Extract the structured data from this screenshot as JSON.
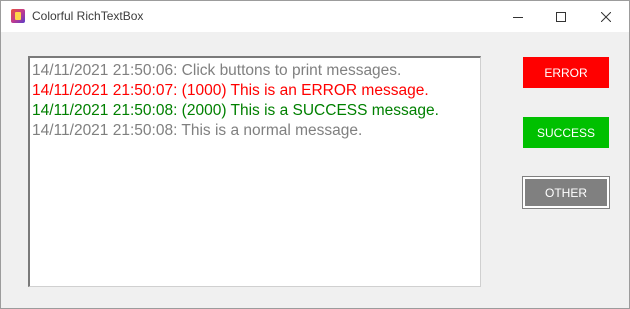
{
  "window": {
    "title": "Colorful RichTextBox"
  },
  "titlebar_controls": {
    "minimize_icon": "minimize-icon",
    "maximize_icon": "maximize-icon",
    "close_icon": "close-icon"
  },
  "log": {
    "lines": [
      {
        "text": "14/11/2021 21:50:06: Click buttons to print messages.",
        "color": "#808080"
      },
      {
        "text": "14/11/2021 21:50:07: (1000) This is an ERROR message.",
        "color": "#ff0000"
      },
      {
        "text": "14/11/2021 21:50:08: (2000) This is a SUCCESS message.",
        "color": "#008000"
      },
      {
        "text": "14/11/2021 21:50:08: This is a normal message.",
        "color": "#808080"
      }
    ]
  },
  "buttons": {
    "error": {
      "label": "ERROR",
      "color": "#ff0000"
    },
    "success": {
      "label": "SUCCESS",
      "color": "#00c000"
    },
    "other": {
      "label": "OTHER",
      "color": "#808080"
    }
  }
}
